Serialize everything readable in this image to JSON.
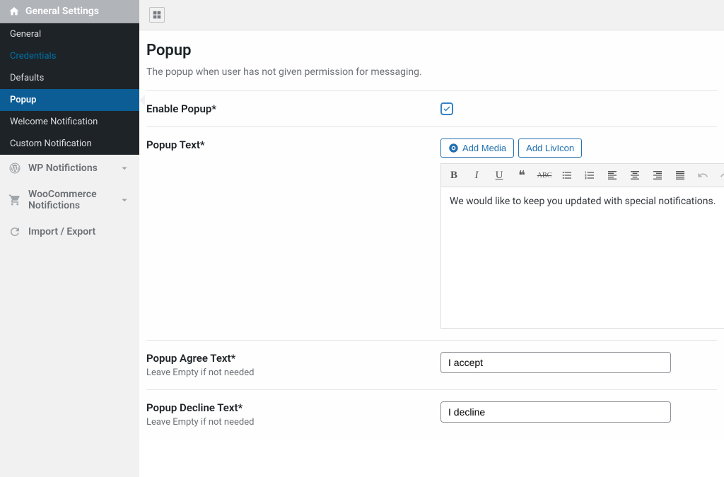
{
  "sidebar": {
    "header": "General Settings",
    "submenu": [
      {
        "label": "General",
        "state": ""
      },
      {
        "label": "Credentials",
        "state": "highlight"
      },
      {
        "label": "Defaults",
        "state": ""
      },
      {
        "label": "Popup",
        "state": "current"
      },
      {
        "label": "Welcome Notification",
        "state": ""
      },
      {
        "label": "Custom Notification",
        "state": ""
      }
    ],
    "nav": [
      {
        "label": "WP Notifictions"
      },
      {
        "label": "WooCommerce Notifictions"
      },
      {
        "label": "Import / Export"
      }
    ]
  },
  "page": {
    "title": "Popup",
    "desc": "The popup when user has not given permission for messaging."
  },
  "fields": {
    "enable_label": "Enable Popup*",
    "text_label": "Popup Text*",
    "add_media": "Add Media",
    "add_livicon": "Add LivIcon",
    "text_value": "We would like to keep you updated with special notifications.",
    "agree_label": "Popup Agree Text*",
    "agree_help": "Leave Empty if not needed",
    "agree_value": "I accept",
    "decline_label": "Popup Decline Text*",
    "decline_help": "Leave Empty if not needed",
    "decline_value": "I decline"
  }
}
